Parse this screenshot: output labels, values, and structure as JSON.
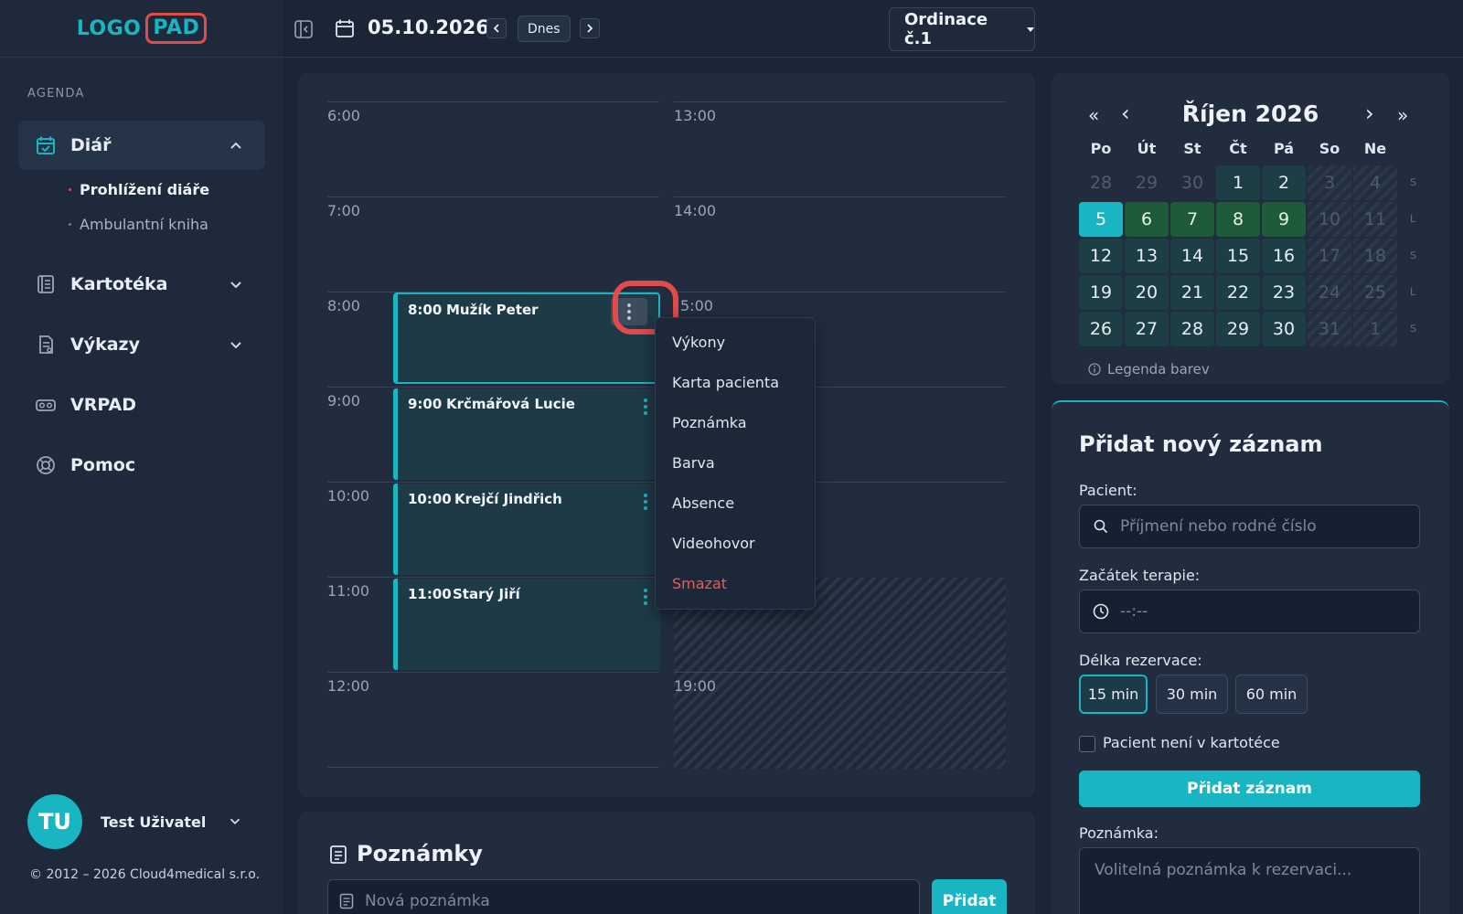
{
  "logo": {
    "part1": "LOGO",
    "part2": "PAD"
  },
  "sidebar": {
    "section_label": "AGENDA",
    "items": [
      {
        "label": "Diář",
        "icon": "calendar-check-icon"
      },
      {
        "label": "Kartotéka",
        "icon": "address-book-icon"
      },
      {
        "label": "Výkazy",
        "icon": "report-icon"
      },
      {
        "label": "VRPAD",
        "icon": "vr-headset-icon"
      },
      {
        "label": "Pomoc",
        "icon": "lifebuoy-icon"
      }
    ],
    "subitems": [
      {
        "label": "Prohlížení diáře"
      },
      {
        "label": "Ambulantní kniha"
      }
    ],
    "user": {
      "initials": "TU",
      "name": "Test Uživatel"
    },
    "copyright": "© 2012 – 2026 Cloud4medical s.r.o."
  },
  "topbar": {
    "date": "05.10.2026",
    "today_label": "Dnes",
    "office": "Ordinace č.1"
  },
  "schedule": {
    "times_left": [
      "6:00",
      "7:00",
      "8:00",
      "9:00",
      "10:00",
      "11:00",
      "12:00"
    ],
    "times_right": [
      "13:00",
      "14:00",
      "5:00",
      "19:00"
    ],
    "appointments": [
      {
        "time": "8:00",
        "name": "Mužík Peter"
      },
      {
        "time": "9:00",
        "name": "Krčmářová Lucie"
      },
      {
        "time": "10:00",
        "name": "Krejčí Jindřich"
      },
      {
        "time": "11:00",
        "name": "Starý Jiří"
      }
    ],
    "context_menu": [
      "Výkony",
      "Karta pacienta",
      "Poznámka",
      "Barva",
      "Absence",
      "Videohovor",
      "Smazat"
    ]
  },
  "calendar": {
    "title": "Říjen 2026",
    "nav": {
      "first": "«",
      "prev": "‹",
      "next": "›",
      "last": "»"
    },
    "weekdays": [
      "Po",
      "Út",
      "St",
      "Čt",
      "Pá",
      "So",
      "Ne"
    ],
    "weeks": [
      {
        "days": [
          "28",
          "29",
          "30",
          "1",
          "2",
          "3",
          "4"
        ],
        "tag": "S"
      },
      {
        "days": [
          "5",
          "6",
          "7",
          "8",
          "9",
          "10",
          "11"
        ],
        "tag": "L"
      },
      {
        "days": [
          "12",
          "13",
          "14",
          "15",
          "16",
          "17",
          "18"
        ],
        "tag": "S"
      },
      {
        "days": [
          "19",
          "20",
          "21",
          "22",
          "23",
          "24",
          "25"
        ],
        "tag": "L"
      },
      {
        "days": [
          "26",
          "27",
          "28",
          "29",
          "30",
          "31",
          "1"
        ],
        "tag": "S"
      }
    ],
    "legend": "Legenda barev",
    "colors": {
      "selected": "#1ab5c3",
      "green": "#1f5a3a",
      "teal": "#1d3e45",
      "weekend": "#2b3849"
    }
  },
  "form": {
    "title": "Přidat nový záznam",
    "patient_label": "Pacient:",
    "patient_placeholder": "Příjmení nebo rodné číslo",
    "start_label": "Začátek terapie:",
    "start_placeholder": "--:--",
    "duration_label": "Délka rezervace:",
    "durations": [
      "15 min",
      "30 min",
      "60 min"
    ],
    "selected_duration": "15 min",
    "checkbox_label": "Pacient není v kartotéce",
    "submit": "Přidat záznam",
    "note_label": "Poznámka:",
    "note_placeholder": "Volitelná poznámka k rezervaci..."
  },
  "notes": {
    "title": "Poznámky",
    "input_placeholder": "Nová poznámka",
    "add": "Přidat"
  },
  "accent_color": "#1ab5c3",
  "highlight_color": "#e04b4b"
}
